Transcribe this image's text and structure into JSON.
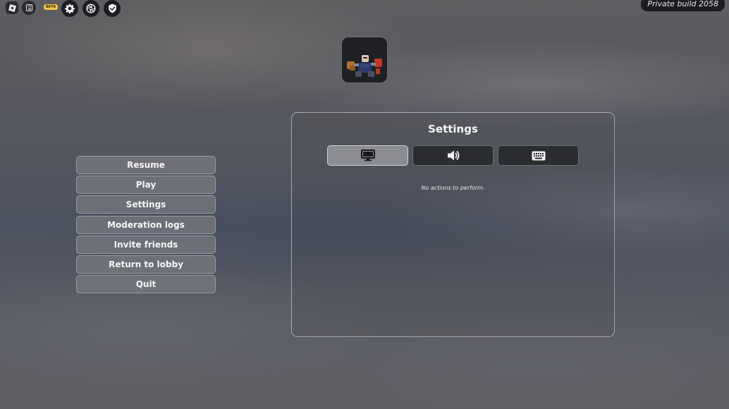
{
  "topbar": {
    "roblox_icon": "roblox-logo-icon",
    "chat_icon": "chat-icon",
    "beta_label": "BETA",
    "gear_icon": "gear-icon",
    "aperture_icon": "aperture-icon",
    "shield_icon": "shield-check-icon",
    "build_label": "Private build 2058"
  },
  "menu": {
    "items": [
      {
        "label": "Resume"
      },
      {
        "label": "Play"
      },
      {
        "label": "Settings"
      },
      {
        "label": "Moderation logs"
      },
      {
        "label": "Invite friends"
      },
      {
        "label": "Return to lobby"
      },
      {
        "label": "Quit"
      }
    ]
  },
  "settings": {
    "title": "Settings",
    "tabs": [
      {
        "icon": "monitor-icon",
        "active": true
      },
      {
        "icon": "speaker-icon",
        "active": false
      },
      {
        "icon": "keyboard-icon",
        "active": false
      }
    ],
    "empty_message": "No actions to perform."
  },
  "colors": {
    "beta_badge": "#f3c84b",
    "tab_active": "#96989e",
    "tab_inactive": "#2b2c30"
  }
}
